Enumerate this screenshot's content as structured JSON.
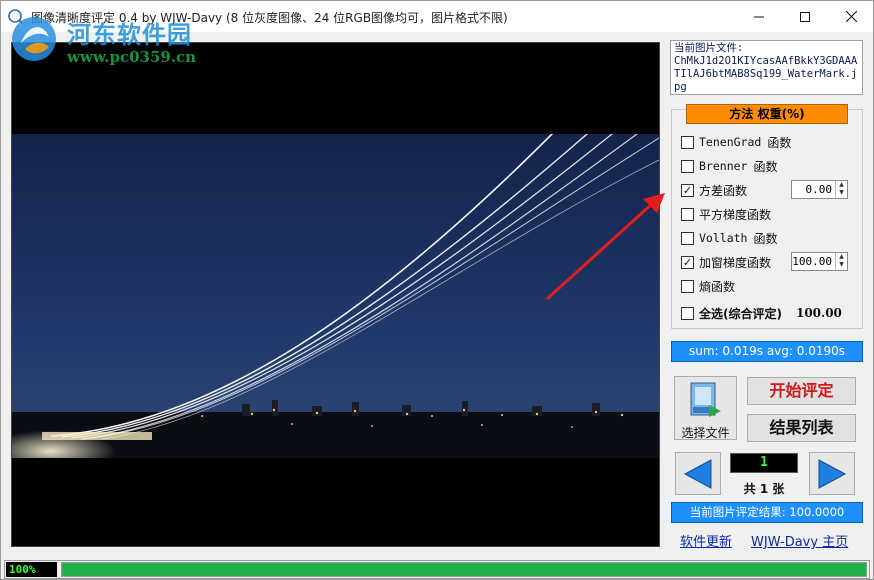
{
  "window": {
    "title": "图像清晰度评定 0.4 by WJW-Davy  (8 位灰度图像、24 位RGB图像均可，图片格式不限)"
  },
  "watermark": {
    "site_name": "河东软件园",
    "url": "www.pc0359.cn"
  },
  "file_info": {
    "label": "当前图片文件:",
    "filename": "ChMkJ1d2O1KIYcasAAfBkkY3GDAAATIlAJ6btMAB8Sq199_WaterMark.jpg"
  },
  "methods": {
    "header": "方法  权重(%)",
    "items": [
      {
        "name": "TenenGrad",
        "suffix": "函数",
        "checked": false
      },
      {
        "name": "Brenner",
        "suffix": "函数",
        "checked": false
      },
      {
        "name": "方差函数",
        "suffix": "",
        "checked": true,
        "weight": "0.00"
      },
      {
        "name": "平方梯度函数",
        "suffix": "",
        "checked": false
      },
      {
        "name": "Vollath",
        "suffix": "函数",
        "checked": false
      },
      {
        "name": "加窗梯度函数",
        "suffix": "",
        "checked": true,
        "weight": "100.00"
      },
      {
        "name": "熵函数",
        "suffix": "",
        "checked": false
      }
    ],
    "select_all_label": "全选(综合评定)",
    "select_all_score": "100.00"
  },
  "timing": "sum: 0.019s  avg: 0.0190s",
  "buttons": {
    "pick_file": "选择文件",
    "start": "开始评定",
    "result_list": "结果列表"
  },
  "navigation": {
    "current": "1",
    "total_text": "共 1 张"
  },
  "result": "当前图片评定结果: 100.0000",
  "links": {
    "update": "软件更新",
    "homepage": "WJW-Davy 主页"
  },
  "status": {
    "percent_text": "100%",
    "progress": 1.0
  },
  "colors": {
    "accent_blue": "#1e90ff",
    "method_header": "#ff8c00",
    "start_text": "#d01818",
    "progress_green": "#22b04a"
  }
}
